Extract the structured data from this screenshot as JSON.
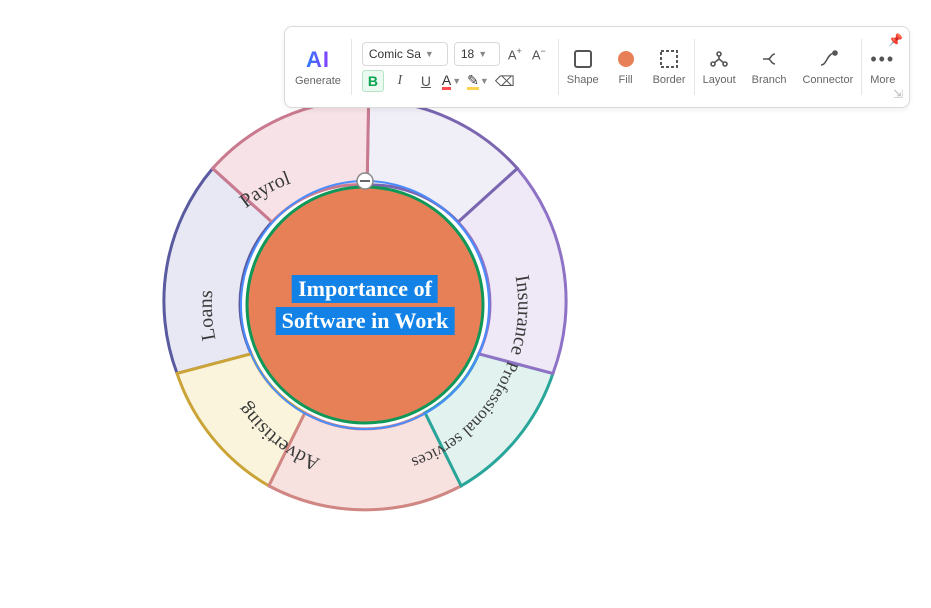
{
  "toolbar": {
    "ai_glyph": "AI",
    "ai_label": "Generate",
    "font_name": "Comic Sa",
    "font_size": "18",
    "shape_label": "Shape",
    "fill_label": "Fill",
    "border_label": "Border",
    "layout_label": "Layout",
    "branch_label": "Branch",
    "connector_label": "Connector",
    "more_label": "More",
    "colors": {
      "fill": "#e88057"
    }
  },
  "diagram": {
    "center_line1": "Importance of",
    "center_line2": "Software in Work",
    "segments": [
      {
        "label": "Payroll",
        "fill": "#e8e8f4",
        "stroke": "#5a5aa0"
      },
      {
        "label": "Loans",
        "fill": "#faf4dc",
        "stroke": "#cba438"
      },
      {
        "label": "Advertising",
        "fill": "#f7e2e0",
        "stroke": "#d08682"
      },
      {
        "label": "Professional services",
        "fill": "#e1f2ef",
        "stroke": "#2aa59a"
      },
      {
        "label": "Insurance",
        "fill": "#eee8f7",
        "stroke": "#8e72c6"
      },
      {
        "label": "",
        "fill": "#f0eef7",
        "stroke": "#7a66b0"
      },
      {
        "label": "",
        "fill": "#f7e2e7",
        "stroke": "#c97a8f"
      }
    ],
    "center": {
      "fill": "#e88057",
      "ring1": "#109859",
      "ring2": "#4a8dff"
    }
  }
}
